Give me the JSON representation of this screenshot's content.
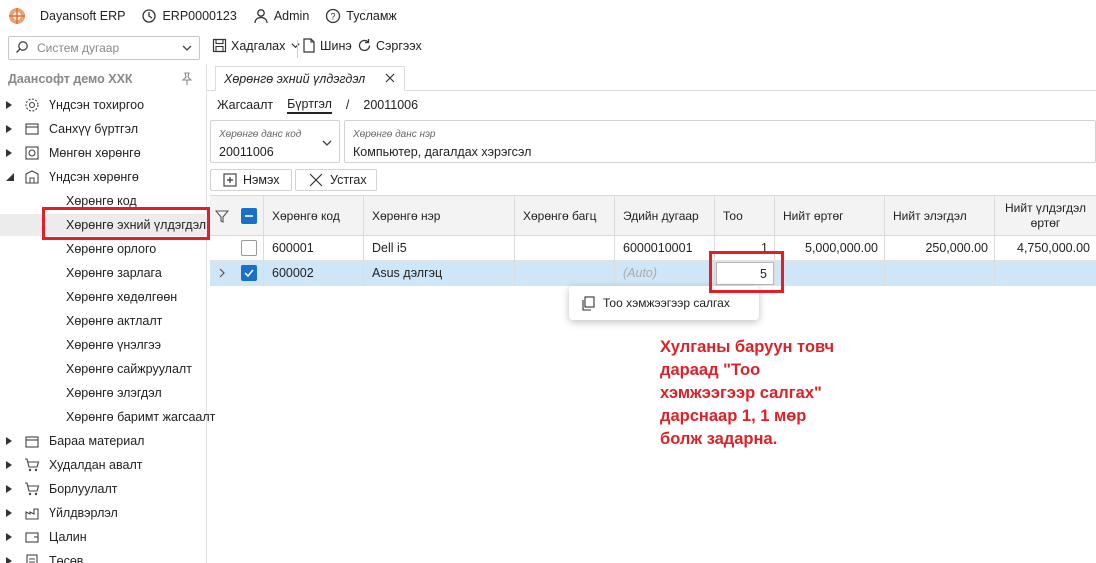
{
  "titlebar": {
    "app_name": "Dayansoft ERP",
    "db_code": "ERP0000123",
    "user": "Admin",
    "help": "Тусламж"
  },
  "toolbar": {
    "search_placeholder": "Систем дугаар",
    "save_label": "Хадгалах",
    "new_label": "Шинэ",
    "refresh_label": "Сэргээх"
  },
  "sidebar": {
    "company": "Даансофт демо ХХК",
    "items_top": [
      {
        "label": "Үндсэн тохиргоо",
        "icon": "gear-icon"
      },
      {
        "label": "Санхүү бүртгэл",
        "icon": "ledger-icon"
      },
      {
        "label": "Мөнгөн хөрөнгө",
        "icon": "cash-icon"
      },
      {
        "label": "Үндсэн хөрөнгө",
        "icon": "building-icon"
      }
    ],
    "children": [
      {
        "label": "Хөрөнгө код"
      },
      {
        "label": "Хөрөнгө эхний үлдэгдэл"
      },
      {
        "label": "Хөрөнгө орлого"
      },
      {
        "label": "Хөрөнгө зарлага"
      },
      {
        "label": "Хөрөнгө хөдөлгөөн"
      },
      {
        "label": "Хөрөнгө актлалт"
      },
      {
        "label": "Хөрөнгө үнэлгээ"
      },
      {
        "label": "Хөрөнгө сайжруулалт"
      },
      {
        "label": "Хөрөнгө элэгдэл"
      },
      {
        "label": "Хөрөнгө баримт жагсаалт"
      }
    ],
    "items_bottom": [
      {
        "label": "Бараа материал",
        "icon": "box-icon"
      },
      {
        "label": "Худалдан авалт",
        "icon": "cart-icon"
      },
      {
        "label": "Борлуулалт",
        "icon": "cart-icon"
      },
      {
        "label": "Үйлдвэрлэл",
        "icon": "factory-icon"
      },
      {
        "label": "Цалин",
        "icon": "wallet-icon"
      },
      {
        "label": "Төсөв",
        "icon": "budget-icon"
      }
    ]
  },
  "tab": {
    "label": "Хөрөнгө эхний үлдэгдэл"
  },
  "breadcrumb": {
    "list": "Жагсаалт",
    "register": "Бүртгэл",
    "sep": "/",
    "code": "20011006"
  },
  "form": {
    "account_code_label": "Хөрөнгө данс код",
    "account_code_value": "20011006",
    "account_name_label": "Хөрөнгө данс нэр",
    "account_name_value": "Компьютер, дагалдах хэрэгсэл"
  },
  "actions": {
    "add": "Нэмэх",
    "delete": "Устгах"
  },
  "grid": {
    "columns": [
      "Хөрөнгө код",
      "Хөрөнгө нэр",
      "Хөрөнгө багц",
      "Эдийн дугаар",
      "Тоо",
      "Нийт өртөг",
      "Нийт элэгдэл",
      "Нийт үлдэгдэл өртөг"
    ],
    "rows": [
      {
        "code": "600001",
        "name": "Dell i5",
        "group": "",
        "serial": "6000010001",
        "qty": "1",
        "cost": "5,000,000.00",
        "depr": "250,000.00",
        "residual": "4,750,000.00"
      },
      {
        "code": "600002",
        "name": "Asus дэлгэц",
        "group": "",
        "serial": "(Auto)",
        "qty": "5",
        "cost": "",
        "depr": "",
        "residual": ""
      }
    ]
  },
  "context_menu": {
    "split_label": "Тоо хэмжээгээр салгах"
  },
  "annotation": {
    "lines": [
      "Хулганы баруун товч",
      "дараад \"Тоо",
      "хэмжээгээр салгах\"",
      "дарснаар 1, 1 мөр",
      "болж задарна."
    ]
  },
  "colors": {
    "accent": "#1a6fc9",
    "selected_row": "#cfe6f8",
    "highlight_red": "#e01f26"
  }
}
